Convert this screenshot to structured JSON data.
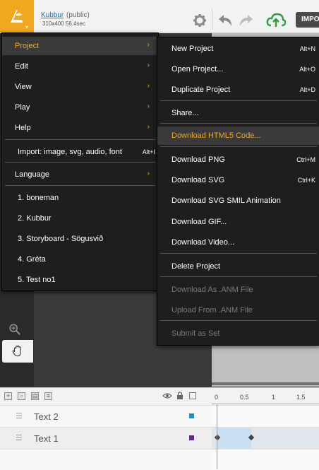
{
  "header": {
    "project_name": "Kubbur",
    "visibility": "(public)",
    "meta": "310x400  56.4sec",
    "import_label": "IMPO",
    "accent_color": "#f1a81e"
  },
  "main_menu": {
    "items": [
      {
        "label": "Project",
        "arrow": "›"
      },
      {
        "label": "Edit",
        "arrow": "›"
      },
      {
        "label": "View",
        "arrow": "›"
      },
      {
        "label": "Play",
        "arrow": "›"
      },
      {
        "label": "Help",
        "arrow": "›"
      }
    ],
    "import": {
      "label": "Import: image, svg, audio, font",
      "shortcut": "Alt+I"
    },
    "language": {
      "label": "Language",
      "arrow": "›"
    },
    "recent": [
      "1. boneman",
      "2. Kubbur",
      "3. Storyboard - Sögusvið",
      "4. Gréta",
      "5. Test no1"
    ]
  },
  "project_menu": {
    "new": {
      "label": "New Project",
      "shortcut": "Alt+N"
    },
    "open": {
      "label": "Open Project...",
      "shortcut": "Alt+O"
    },
    "duplicate": {
      "label": "Duplicate Project",
      "shortcut": "Alt+D"
    },
    "share": {
      "label": "Share..."
    },
    "download_html5": {
      "label": "Download HTML5 Code..."
    },
    "download_png": {
      "label": "Download PNG",
      "shortcut": "Ctrl+M"
    },
    "download_svg": {
      "label": "Download SVG",
      "shortcut": "Ctrl+K"
    },
    "download_smil": {
      "label": "Download SVG SMIL Animation"
    },
    "download_gif": {
      "label": "Download GIF..."
    },
    "download_video": {
      "label": "Download Video..."
    },
    "delete": {
      "label": "Delete Project"
    },
    "download_anm": {
      "label": "Download As .ANM File"
    },
    "upload_anm": {
      "label": "Upload From .ANM File"
    },
    "submit_set": {
      "label": "Submit as Set"
    }
  },
  "timeline": {
    "ticks": [
      "0",
      "0.5",
      "1",
      "1.5"
    ],
    "layers": [
      {
        "name": "Text 2",
        "color": "#1a8fd1"
      },
      {
        "name": "Text 1",
        "color": "#5b2d7e"
      }
    ]
  }
}
